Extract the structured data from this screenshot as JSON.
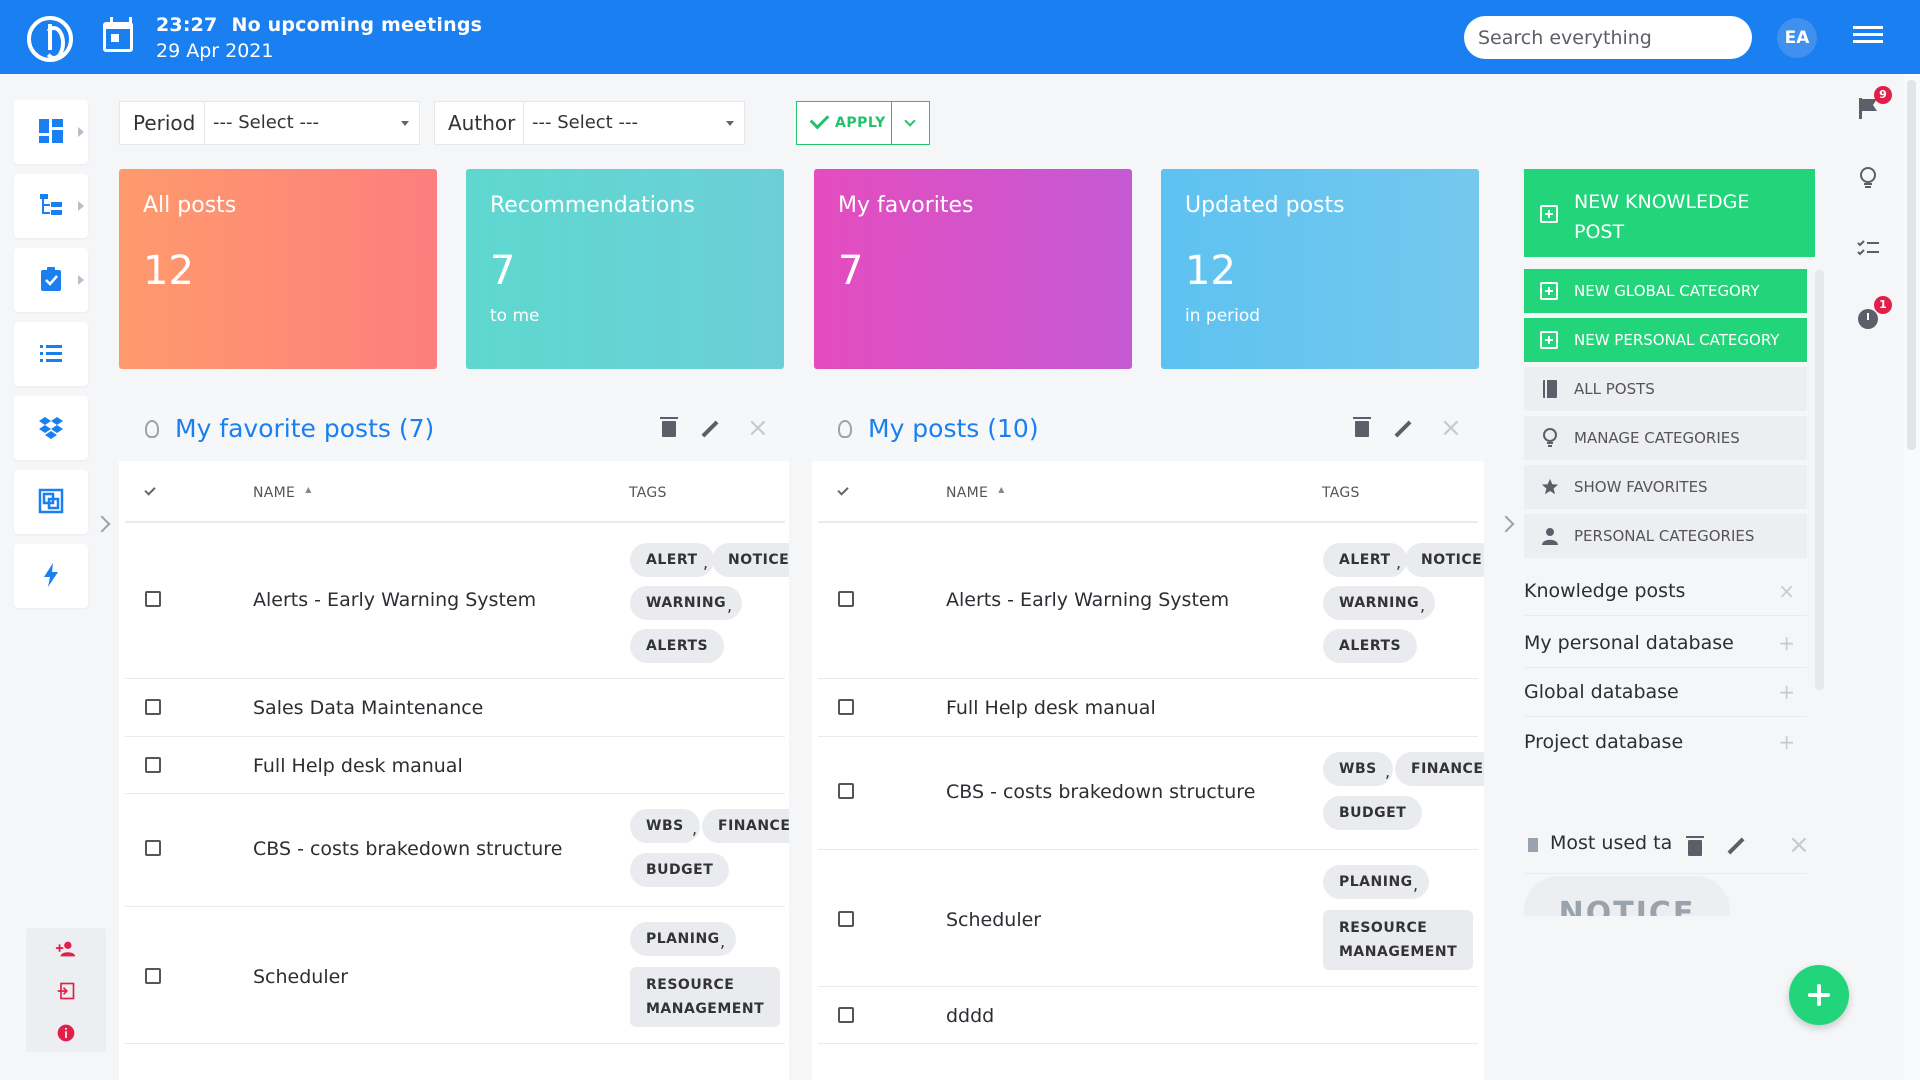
{
  "topbar": {
    "time": "23:27",
    "meetings": "No upcoming meetings",
    "date": "29 Apr 2021",
    "search_placeholder": "Search everything",
    "avatar_initials": "EA"
  },
  "filters": {
    "period_label": "Period",
    "period_value": "--- Select ---",
    "author_label": "Author",
    "author_value": "--- Select ---",
    "apply_label": "APPLY"
  },
  "cards": [
    {
      "title": "All posts",
      "value": "12",
      "sub": "",
      "color_from": "#ff9a6c",
      "color_to": "#fc7e7e"
    },
    {
      "title": "Recommendations",
      "value": "7",
      "sub": "to me",
      "color_from": "#5ed8cf",
      "color_to": "#6ccfd8"
    },
    {
      "title": "My favorites",
      "value": "7",
      "sub": "",
      "color_from": "#e44cbf",
      "color_to": "#c55ad4"
    },
    {
      "title": "Updated posts",
      "value": "12",
      "sub": "in period",
      "color_from": "#5ec2f0",
      "color_to": "#74c8ee"
    }
  ],
  "panel_left": {
    "title": "My favorite posts (7)",
    "col_name": "NAME",
    "col_tags": "TAGS",
    "rows": [
      {
        "name": "Alerts - Early Warning System",
        "tags": [
          "ALERT",
          "NOTICE",
          "WARNING",
          "ALERTS"
        ]
      },
      {
        "name": "Sales Data Maintenance",
        "tags": []
      },
      {
        "name": "Full Help desk manual",
        "tags": []
      },
      {
        "name": "CBS - costs brakedown structure",
        "tags": [
          "WBS",
          "FINANCES",
          "BUDGET"
        ]
      },
      {
        "name": "Scheduler",
        "tags": [
          "PLANING",
          "RESOURCE",
          "MANAGEMENT"
        ]
      }
    ]
  },
  "panel_right": {
    "title": "My posts (10)",
    "col_name": "NAME",
    "col_tags": "TAGS",
    "rows": [
      {
        "name": "Alerts - Early Warning System",
        "tags": [
          "ALERT",
          "NOTICE",
          "WARNING",
          "ALERTS"
        ]
      },
      {
        "name": "Full Help desk manual",
        "tags": []
      },
      {
        "name": "CBS - costs brakedown structure",
        "tags": [
          "WBS",
          "FINANCES",
          "BUDGET"
        ]
      },
      {
        "name": "Scheduler",
        "tags": [
          "PLANING",
          "RESOURCE",
          "MANAGEMENT"
        ]
      },
      {
        "name": "dddd",
        "tags": []
      }
    ]
  },
  "sidebar_actions": {
    "new_post": "NEW KNOWLEDGE POST",
    "new_global": "NEW GLOBAL CATEGORY",
    "new_personal": "NEW PERSONAL CATEGORY",
    "all_posts": "ALL POSTS",
    "manage_categories": "MANAGE CATEGORIES",
    "show_favorites": "SHOW FAVORITES",
    "personal_categories": "PERSONAL CATEGORIES"
  },
  "databases": [
    "Knowledge posts",
    "My personal database",
    "Global database",
    "Project database"
  ],
  "most_used": {
    "title": "Most used ta",
    "tag": "NOTICE"
  },
  "badges": {
    "flags": "9",
    "timer": "1"
  },
  "icons": [
    "dashboard-icon",
    "hierarchy-icon",
    "task-icon",
    "list-icon",
    "dropbox-icon",
    "layers-icon",
    "bolt-icon",
    "flag-icon",
    "bulb-icon",
    "checklist-icon",
    "timer-icon"
  ]
}
